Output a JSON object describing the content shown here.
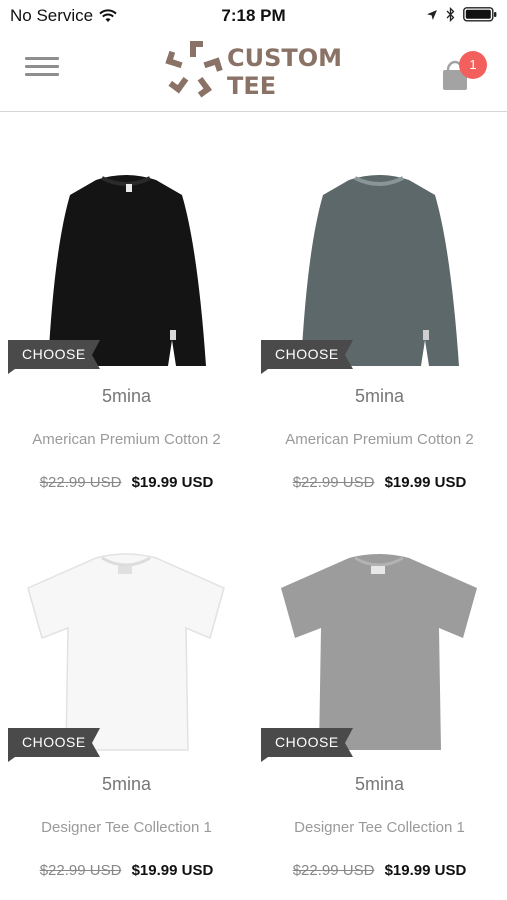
{
  "status_bar": {
    "carrier": "No Service",
    "time": "7:18 PM"
  },
  "header": {
    "logo_line1": "CUSTOM",
    "logo_line2": "TEE",
    "cart_count": "1"
  },
  "colors": {
    "accent_badge": "#f25f5c",
    "logo_brown": "#8a7266",
    "ribbon": "#4a4a4a"
  },
  "products": [
    {
      "image": "black-sweatshirt",
      "choose": "CHOOSE",
      "brand": "5mina",
      "name": "American Premium Cotton 2",
      "old_price": "$22.99 USD",
      "price": "$19.99 USD"
    },
    {
      "image": "gray-sweatshirt",
      "choose": "CHOOSE",
      "brand": "5mina",
      "name": "American Premium Cotton 2",
      "old_price": "$22.99 USD",
      "price": "$19.99 USD"
    },
    {
      "image": "white-tshirt",
      "choose": "CHOOSE",
      "brand": "5mina",
      "name": "Designer Tee Collection 1",
      "old_price": "$22.99 USD",
      "price": "$19.99 USD"
    },
    {
      "image": "gray-tshirt",
      "choose": "CHOOSE",
      "brand": "5mina",
      "name": "Designer Tee Collection 1",
      "old_price": "$22.99 USD",
      "price": "$19.99 USD"
    }
  ]
}
